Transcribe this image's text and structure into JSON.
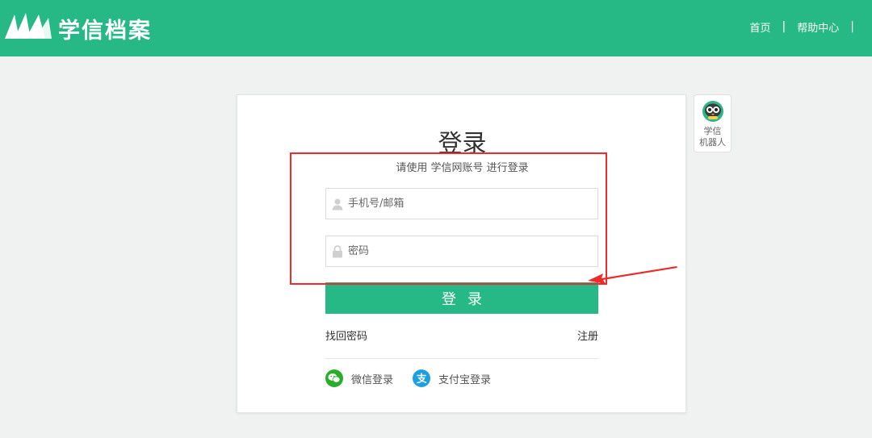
{
  "header": {
    "brand": "学信档案",
    "nav": [
      {
        "label": "首页"
      },
      {
        "label": "帮助中心"
      }
    ],
    "separator": "|"
  },
  "login": {
    "title": "登录",
    "subtitle": "请使用 学信网账号 进行登录",
    "username_placeholder": "手机号/邮箱",
    "password_placeholder": "密码",
    "submit_label": "登录",
    "forgot_label": "找回密码",
    "register_label": "注册",
    "social": [
      {
        "label": "微信登录",
        "icon": "wechat-icon",
        "color": "#2aae2a"
      },
      {
        "label": "支付宝登录",
        "icon": "alipay-icon",
        "color": "#1d9fe2"
      }
    ]
  },
  "robot": {
    "line1": "学信",
    "line2": "机器人"
  },
  "colors": {
    "brand": "#26b885",
    "annotation": "#ee2a2a"
  }
}
